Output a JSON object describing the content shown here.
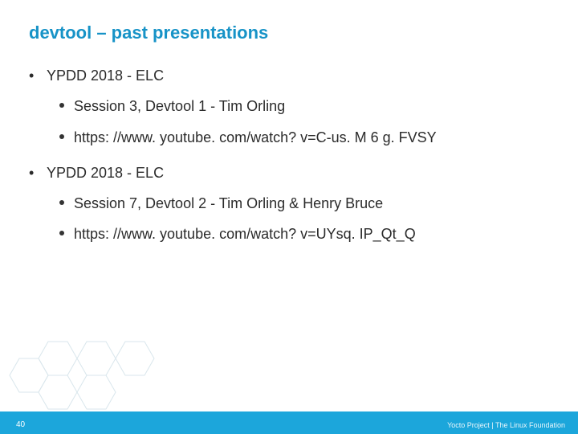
{
  "title": "devtool – past presentations",
  "sections": [
    {
      "heading": "YPDD 2018 - ELC",
      "items": [
        "Session 3, Devtool 1 - Tim Orling",
        "https: //www. youtube. com/watch? v=C-us. M 6 g. FVSY"
      ]
    },
    {
      "heading": "YPDD 2018 - ELC",
      "items": [
        "Session 7, Devtool 2 - Tim Orling & Henry Bruce",
        "https: //www. youtube. com/watch? v=UYsq. IP_Qt_Q"
      ]
    }
  ],
  "footer": {
    "page": "40",
    "credit": "Yocto Project | The Linux Foundation"
  },
  "colors": {
    "accent": "#1793c7",
    "footer_bg": "#1ca6db"
  }
}
